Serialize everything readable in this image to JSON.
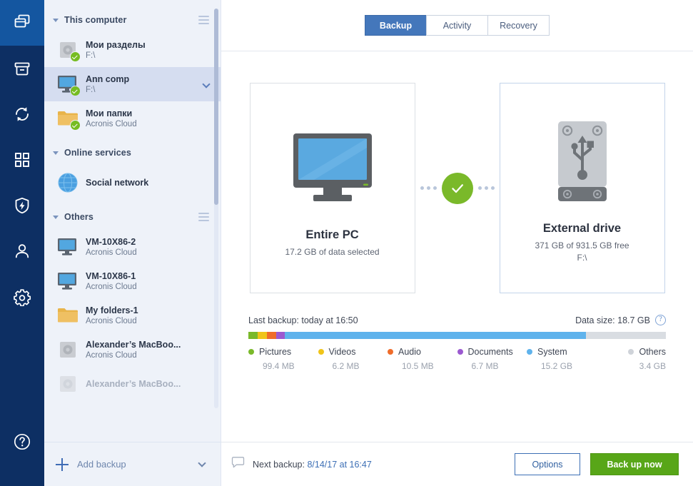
{
  "rail": {
    "items": [
      {
        "name": "backup",
        "icon": "copies-icon",
        "active": true
      },
      {
        "name": "archive",
        "icon": "archive-box-icon",
        "active": false
      },
      {
        "name": "sync",
        "icon": "sync-arrows-icon",
        "active": false
      },
      {
        "name": "tools",
        "icon": "grid-apps-icon",
        "active": false
      },
      {
        "name": "protection",
        "icon": "shield-bolt-icon",
        "active": false
      },
      {
        "name": "account",
        "icon": "person-icon",
        "active": false
      },
      {
        "name": "settings",
        "icon": "gear-icon",
        "active": false
      }
    ],
    "help_icon": "help-circle-icon"
  },
  "sidebar": {
    "groups": [
      {
        "title": "This computer",
        "menu_icon": "hamburger-icon",
        "items": [
          {
            "title": "Мои разделы",
            "subtitle": "F:\\",
            "icon": "hard-disk-icon",
            "badge": "check-badge",
            "selected": false,
            "chevron": false
          },
          {
            "title": "Ann comp",
            "subtitle": "F:\\",
            "icon": "monitor-icon",
            "badge": "check-badge",
            "selected": true,
            "chevron": true
          },
          {
            "title": "Мои папки",
            "subtitle": "Acronis Cloud",
            "icon": "folder-icon",
            "badge": "check-badge",
            "selected": false,
            "chevron": false
          }
        ]
      },
      {
        "title": "Online services",
        "menu_icon": "",
        "items": [
          {
            "title": "Social network",
            "subtitle": "",
            "icon": "globe-icon",
            "badge": "",
            "selected": false,
            "chevron": false
          }
        ]
      },
      {
        "title": "Others",
        "menu_icon": "hamburger-icon",
        "items": [
          {
            "title": "VM-10X86-2",
            "subtitle": "Acronis Cloud",
            "icon": "monitor-icon",
            "badge": "",
            "selected": false,
            "chevron": false
          },
          {
            "title": "VM-10X86-1",
            "subtitle": "Acronis Cloud",
            "icon": "monitor-icon",
            "badge": "",
            "selected": false,
            "chevron": false
          },
          {
            "title": "My folders-1",
            "subtitle": "Acronis Cloud",
            "icon": "folder-icon",
            "badge": "",
            "selected": false,
            "chevron": false
          },
          {
            "title": "Alexander’s MacBoo...",
            "subtitle": "Acronis Cloud",
            "icon": "hard-disk-icon",
            "badge": "",
            "selected": false,
            "chevron": false
          },
          {
            "title": "Alexander’s MacBoo...",
            "subtitle": "",
            "icon": "hard-disk-icon",
            "badge": "",
            "selected": false,
            "chevron": false
          }
        ]
      }
    ],
    "add_backup": {
      "label": "Add backup",
      "plus_icon": "plus-icon",
      "caret_icon": "chevron-down-icon"
    }
  },
  "tabs": [
    {
      "label": "Backup",
      "active": true
    },
    {
      "label": "Activity",
      "active": false
    },
    {
      "label": "Recovery",
      "active": false
    }
  ],
  "source_card": {
    "title": "Entire PC",
    "subtitle": "17.2 GB of data selected",
    "icon": "monitor-icon"
  },
  "destination_card": {
    "title": "External drive",
    "subtitle": "371 GB of 931.5 GB free",
    "subtitle2": "F:\\",
    "icon": "external-drive-usb-icon"
  },
  "connector": {
    "status_icon": "check-circle-icon"
  },
  "stats": {
    "last_backup": "Last backup: today at 16:50",
    "data_size": "Data size: 18.7 GB",
    "help_icon": "help-circle-icon"
  },
  "chart_data": {
    "type": "bar",
    "title": "Data size: 18.7 GB",
    "categories": [
      "Pictures",
      "Videos",
      "Audio",
      "Documents",
      "System",
      "Others"
    ],
    "values": [
      0.0994,
      0.0062,
      0.0105,
      0.0067,
      15.2,
      3.4
    ],
    "value_labels": [
      "99.4 MB",
      "6.2 MB",
      "10.5 MB",
      "6.7 MB",
      "15.2 GB",
      "3.4 GB"
    ],
    "colors": [
      "#7ab92a",
      "#f0c419",
      "#ef6c2a",
      "#9b59d0",
      "#5fb3ec",
      "#cfd3d9"
    ],
    "segment_widths": [
      2.2,
      2.2,
      2.2,
      2.2,
      72.0,
      19.2
    ],
    "total": 18.7,
    "unit": "GB",
    "ylabel": "",
    "xlabel": ""
  },
  "footer": {
    "comment_icon": "speech-bubble-icon",
    "next_backup_label": "Next backup: ",
    "next_backup_value": "8/14/17 at 16:47",
    "options_label": "Options",
    "backup_now_label": "Back up now"
  },
  "colors": {
    "rail_bg": "#0d2f63",
    "rail_active": "#1456a0",
    "sidebar_bg": "#eef2f9",
    "selected_row": "#d5ddf0",
    "accent_blue": "#4477bb",
    "success_green": "#7ab92a",
    "button_green": "#58a618"
  }
}
